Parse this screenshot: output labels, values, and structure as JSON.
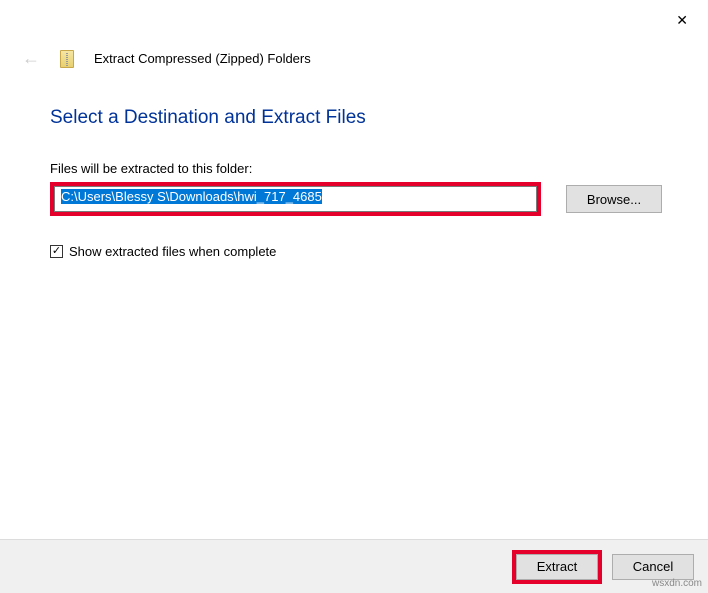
{
  "header": {
    "title": "Extract Compressed (Zipped) Folders"
  },
  "content": {
    "heading": "Select a Destination and Extract Files",
    "pathLabel": "Files will be extracted to this folder:",
    "pathValue": "C:\\Users\\Blessy S\\Downloads\\hwi_717_4685",
    "browseLabel": "Browse...",
    "checkboxLabel": "Show extracted files when complete",
    "checkboxChecked": true
  },
  "footer": {
    "extractLabel": "Extract",
    "cancelLabel": "Cancel"
  },
  "watermark": "wsxdn.com"
}
